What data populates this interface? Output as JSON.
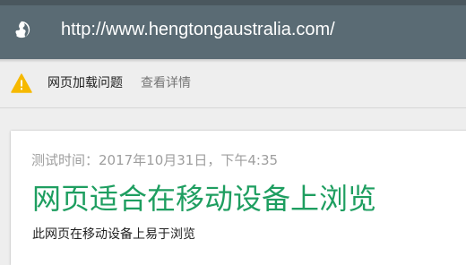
{
  "address_bar": {
    "url": "http://www.hengtongaustralia.com/",
    "icon": "globe-icon"
  },
  "warning_bar": {
    "icon": "warning-icon",
    "label": "网页加载问题",
    "details_link": "查看详情",
    "icon_color": "#f6b900"
  },
  "result_card": {
    "test_time": "测试时间：2017年10月31日，下午4:35",
    "title": "网页适合在移动设备上浏览",
    "description": "此网页在移动设备上易于浏览",
    "title_color": "#1e9e60"
  }
}
